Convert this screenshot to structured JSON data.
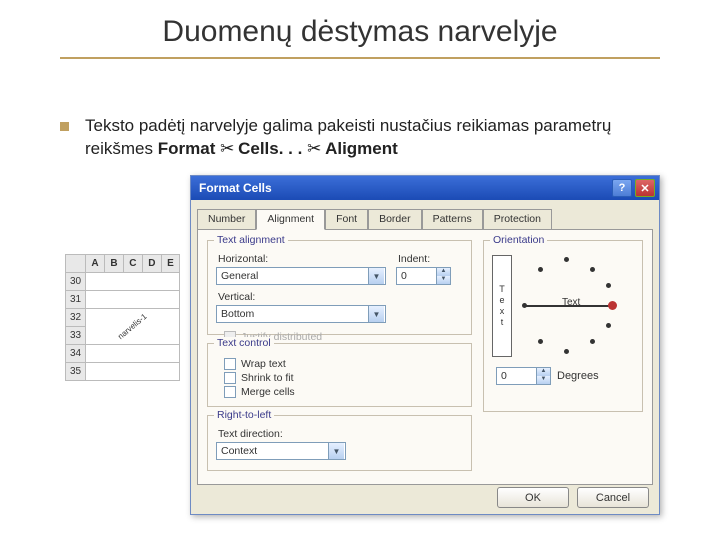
{
  "slide": {
    "title": "Duomenų dėstymas narvelyje",
    "paragraph": "Teksto padėtį narvelyje galima pakeisti nustačius reikiamas parametrų reikšmes",
    "menu1": "Format",
    "sep": "✂",
    "menu2": "Cells. . .",
    "menu3": "Aligment"
  },
  "sheet": {
    "cols": [
      "A",
      "B",
      "C",
      "D",
      "E"
    ],
    "rows": [
      "30",
      "31",
      "32",
      "33",
      "34",
      "35"
    ],
    "diag": "narvelis-1"
  },
  "dialog": {
    "title": "Format Cells",
    "tabs": [
      "Number",
      "Alignment",
      "Font",
      "Border",
      "Patterns",
      "Protection"
    ],
    "active_tab": "Alignment",
    "text_alignment": {
      "legend": "Text alignment",
      "horizontal_label": "Horizontal:",
      "horizontal_value": "General",
      "vertical_label": "Vertical:",
      "vertical_value": "Bottom",
      "indent_label": "Indent:",
      "indent_value": "0",
      "justify_label": "Justify distributed"
    },
    "text_control": {
      "legend": "Text control",
      "wrap": "Wrap text",
      "shrink": "Shrink to fit",
      "merge": "Merge cells"
    },
    "rtl": {
      "legend": "Right-to-left",
      "dir_label": "Text direction:",
      "dir_value": "Context"
    },
    "orientation": {
      "legend": "Orientation",
      "vletters": [
        "T",
        "e",
        "x",
        "t"
      ],
      "text_label": "Text",
      "degrees_value": "0",
      "degrees_label": "Degrees"
    },
    "ok": "OK",
    "cancel": "Cancel"
  }
}
